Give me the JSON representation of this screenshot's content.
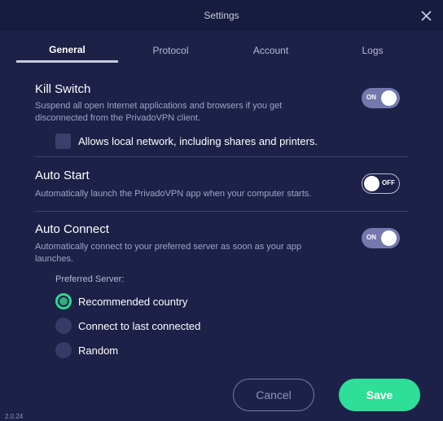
{
  "window": {
    "title": "Settings",
    "close_icon": "close-icon"
  },
  "tabs": [
    {
      "label": "General",
      "active": true
    },
    {
      "label": "Protocol",
      "active": false
    },
    {
      "label": "Account",
      "active": false
    },
    {
      "label": "Logs",
      "active": false
    }
  ],
  "kill_switch": {
    "title": "Kill Switch",
    "desc_line1": "Suspend all open Internet applications and browsers if you get",
    "desc_line2": "disconnected from the PrivadoVPN client.",
    "toggle": "ON",
    "checkbox_label": "Allows local network, including shares and printers."
  },
  "auto_start": {
    "title": "Auto Start",
    "desc": "Automatically launch the PrivadoVPN app when your computer starts.",
    "toggle": "OFF"
  },
  "auto_connect": {
    "title": "Auto Connect",
    "desc_line1": "Automatically connect to your preferred server as soon as your app",
    "desc_line2": "launches.",
    "toggle": "ON",
    "preferred_label": "Preferred Server:",
    "options": [
      "Recommended country",
      "Connect to last connected",
      "Random"
    ],
    "selected_option": "Recommended country"
  },
  "buttons": {
    "cancel": "Cancel",
    "save": "Save"
  },
  "version": "2.0.24",
  "colors": {
    "background": "#1d2148",
    "accent": "#2ddf98",
    "toggle_on": "#7478ad"
  }
}
